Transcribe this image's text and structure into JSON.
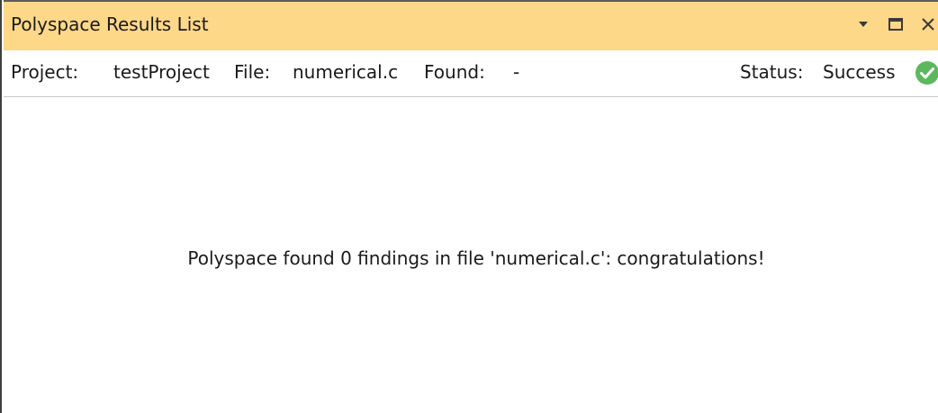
{
  "window": {
    "title": "Polyspace Results List",
    "controls": {
      "menu_icon": "dropdown-arrow-icon",
      "maximize_icon": "maximize-icon",
      "close_icon": "close-icon"
    }
  },
  "info_bar": {
    "project_label": "Project:",
    "project_value": "testProject",
    "file_label": "File:",
    "file_value": "numerical.c",
    "found_label": "Found:",
    "found_value": "-",
    "status_label": "Status:",
    "status_value": "Success",
    "status_icon": "check-circle-icon",
    "status_color": "#5cb85c"
  },
  "content": {
    "message": "Polyspace found 0 findings in file 'numerical.c': congratulations!"
  },
  "colors": {
    "title_bar": "#fdd889",
    "background": "#ffffff",
    "text": "#1a1a1a"
  }
}
